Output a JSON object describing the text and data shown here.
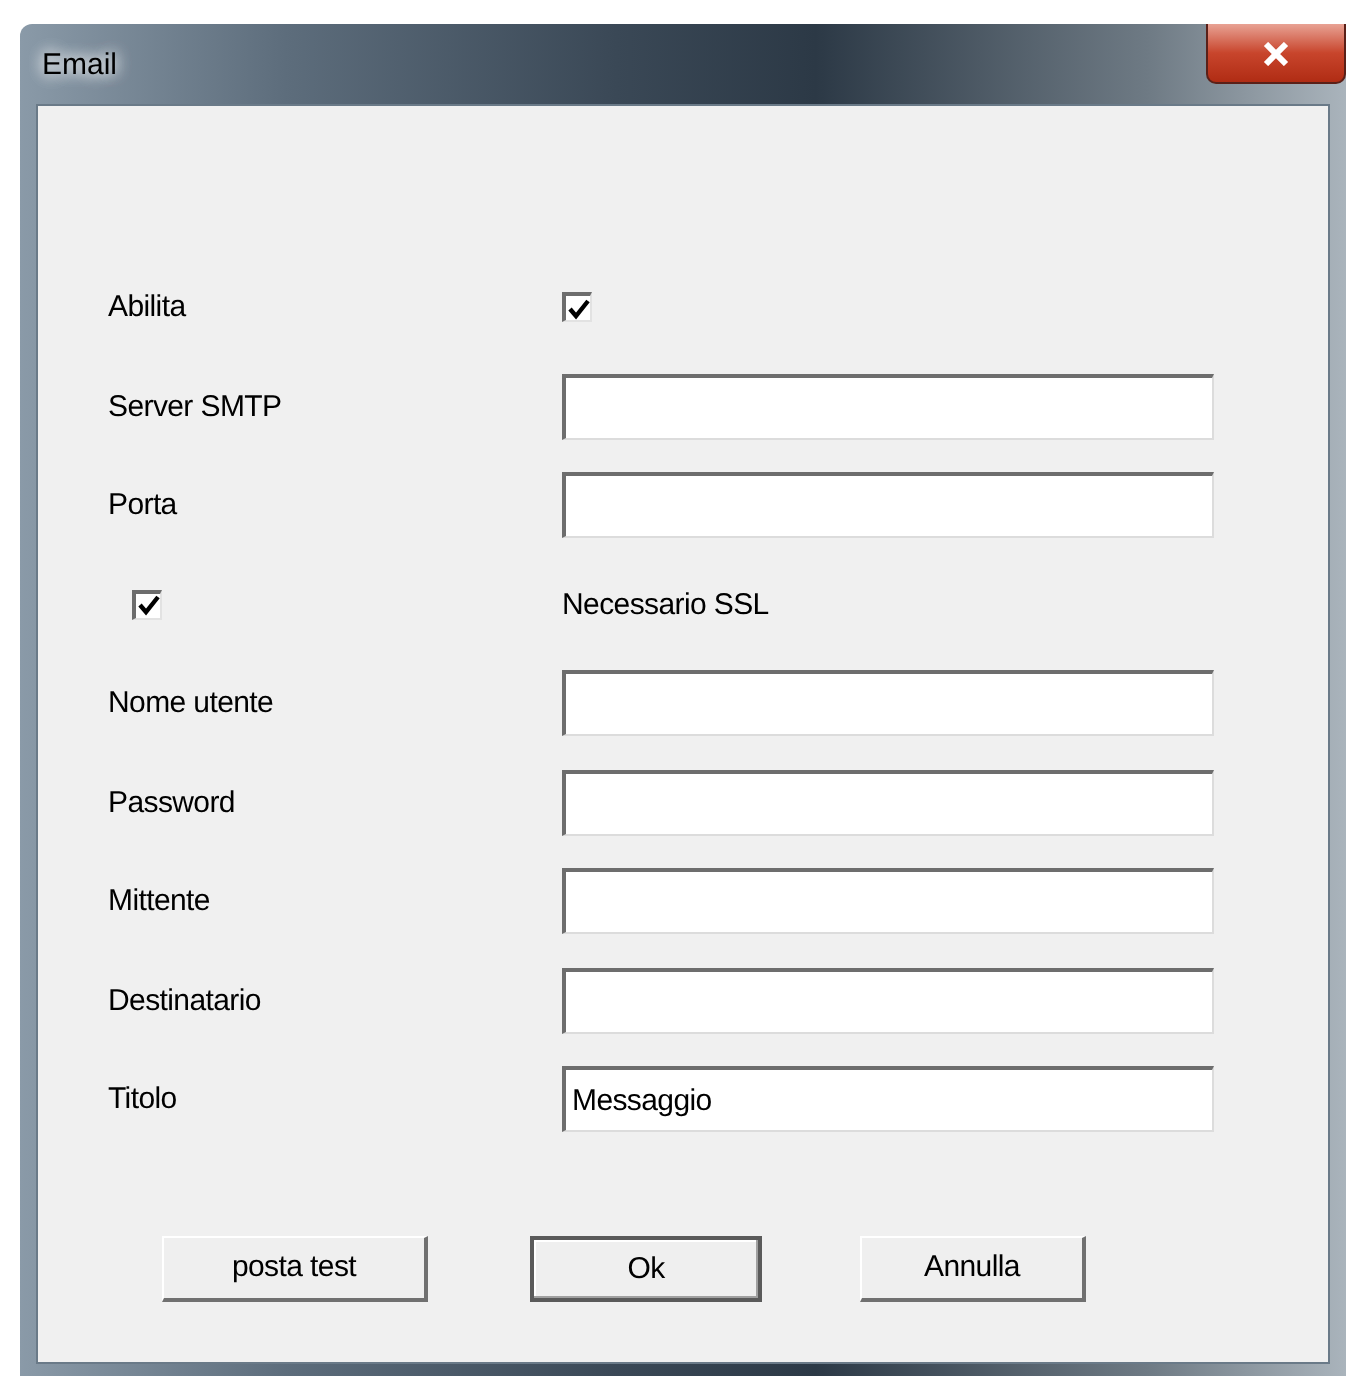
{
  "window": {
    "title": "Email"
  },
  "rows": [
    {
      "kind": "checkbox",
      "label": "Abilita",
      "checked": true
    },
    {
      "kind": "field",
      "label": "Server SMTP"
    },
    {
      "kind": "field",
      "label": "Porta"
    },
    {
      "kind": "checkbox_first",
      "label": "Necessario SSL",
      "checked": true
    },
    {
      "kind": "field",
      "label": "Nome utente"
    },
    {
      "kind": "field",
      "label": "Password"
    },
    {
      "kind": "field",
      "label": "Mittente"
    },
    {
      "kind": "field",
      "label": "Destinatario"
    },
    {
      "kind": "field",
      "label": "Titolo",
      "value": "Messaggio"
    }
  ],
  "buttons": [
    {
      "label": "posta test",
      "default": false
    },
    {
      "label": "Ok",
      "default": true
    },
    {
      "label": "Annulla",
      "default": false
    }
  ]
}
